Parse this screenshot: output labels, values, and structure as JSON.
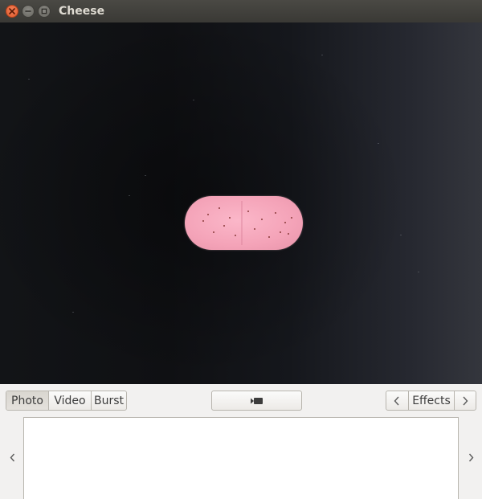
{
  "window": {
    "title": "Cheese",
    "controls": {
      "close_icon": "close-icon",
      "minimize_icon": "minimize-icon",
      "maximize_icon": "maximize-icon"
    }
  },
  "viewport": {
    "subject": "pink-pill-on-dark-background"
  },
  "toolbar": {
    "modes": [
      {
        "label": "Photo",
        "active": true
      },
      {
        "label": "Video",
        "active": false
      },
      {
        "label": "Burst",
        "active": false
      }
    ],
    "record_icon": "video-camera-icon",
    "effects": {
      "label": "Effects",
      "prev_icon": "chevron-left-icon",
      "next_icon": "chevron-right-icon"
    }
  },
  "strip": {
    "prev_icon": "chevron-left-icon",
    "next_icon": "chevron-right-icon"
  },
  "colors": {
    "titlebar": "#3c3b37",
    "close_button": "#e05a2b",
    "toolbar_bg": "#f2f1f0",
    "pill": "#f4a3b8"
  }
}
